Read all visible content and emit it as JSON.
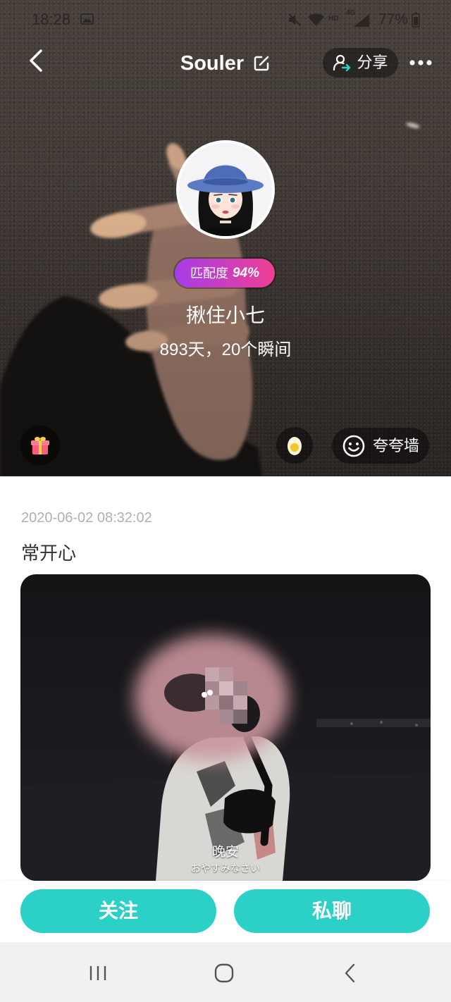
{
  "status_bar": {
    "time": "18:28",
    "hd": "HD",
    "network": "4G",
    "battery": "77%"
  },
  "header": {
    "title": "Souler",
    "share_label": "分享"
  },
  "profile": {
    "match_label": "匹配度",
    "match_value": "94%",
    "name": "揪住小七",
    "stats": "893天，20个瞬间"
  },
  "cover_actions": {
    "praise_wall_label": "夸夸墙"
  },
  "post": {
    "timestamp": "2020-06-02 08:32:02",
    "text": "常开心",
    "caption": "晚安",
    "caption_sub": "おやすみなさい"
  },
  "actions": {
    "follow_label": "关注",
    "chat_label": "私聊"
  },
  "icons": {
    "back": "back-arrow-icon",
    "edit": "edit-icon",
    "share": "share-person-icon",
    "more": "more-icon",
    "gift": "gift-icon",
    "egg": "egg-icon",
    "praise_wall": "smiley-icon",
    "nav_recent": "recent-apps-icon",
    "nav_home": "home-icon",
    "nav_back": "nav-back-icon"
  },
  "colors": {
    "accent": "#2bd1c7",
    "badge_start": "#a63de8",
    "badge_end": "#ee3f92",
    "timestamp": "#b0b0b0",
    "nav_bar": "#f1f1f1"
  }
}
